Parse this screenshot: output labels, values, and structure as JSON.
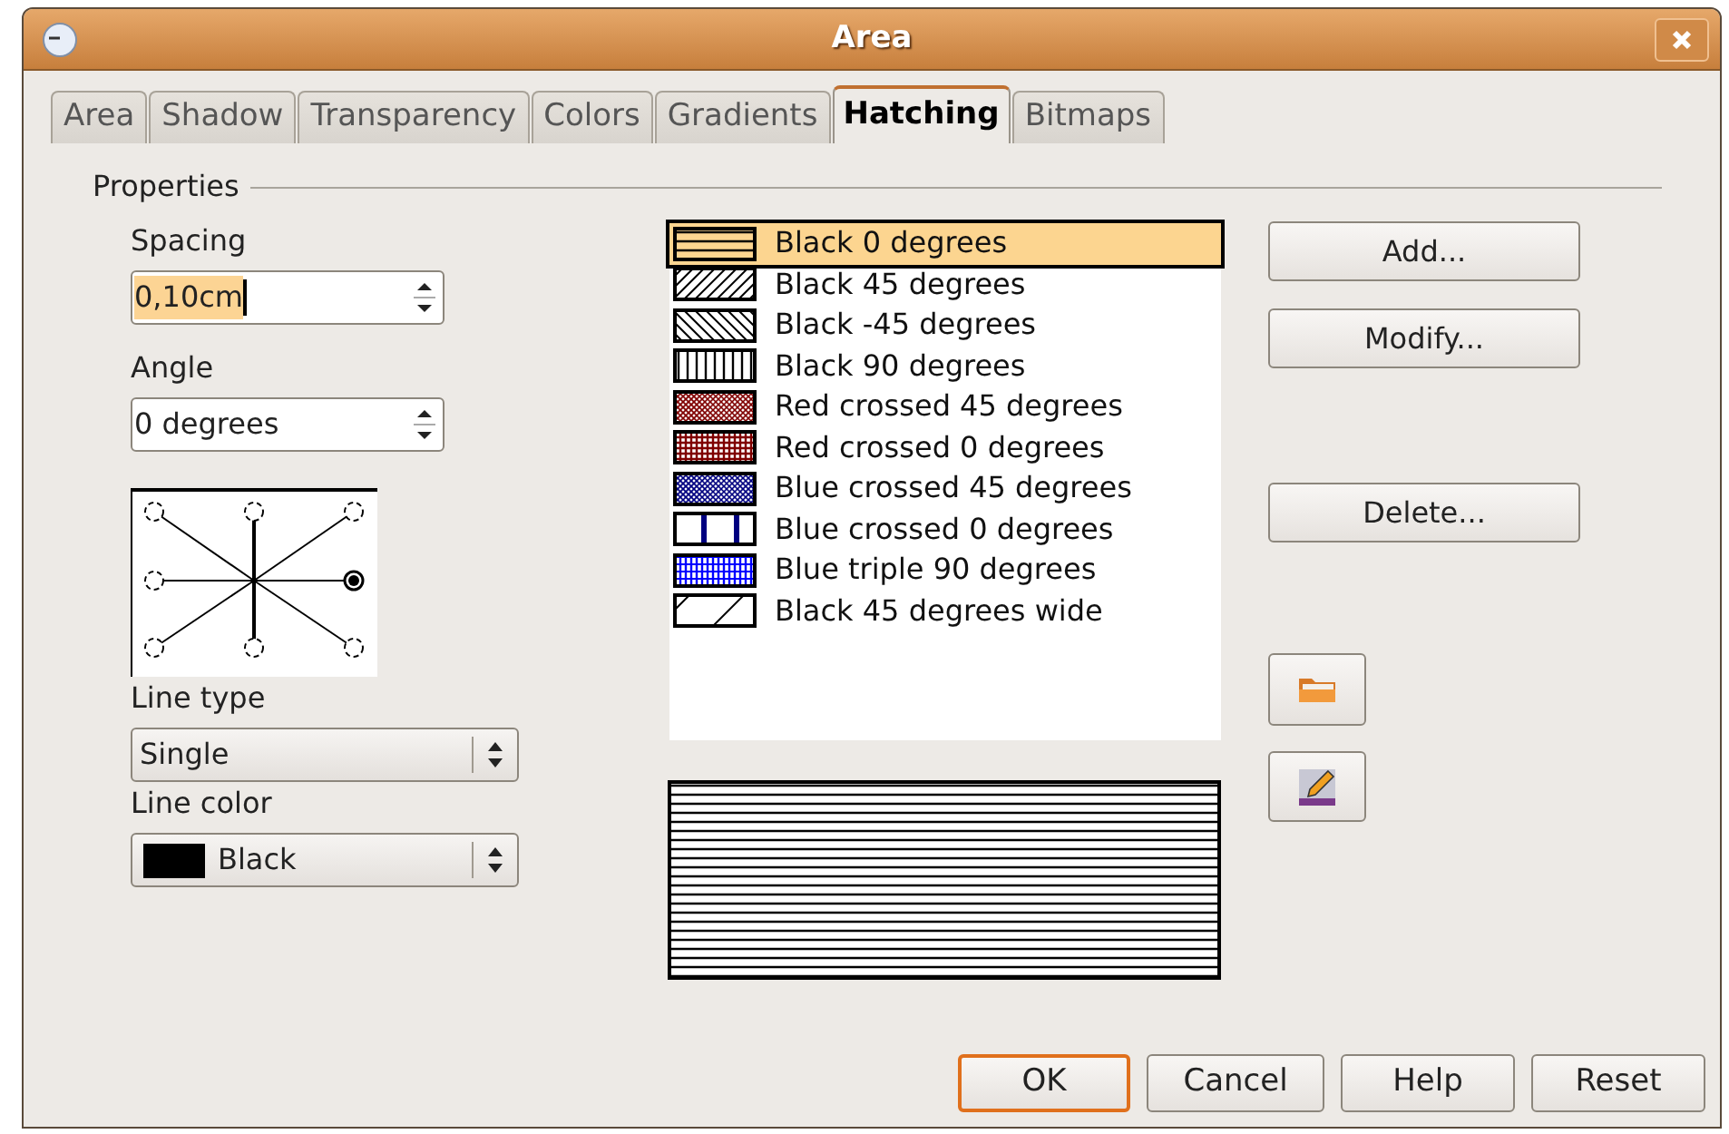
{
  "window": {
    "title": "Area"
  },
  "tabs": [
    {
      "label": "Area",
      "selected": false
    },
    {
      "label": "Shadow",
      "selected": false
    },
    {
      "label": "Transparency",
      "selected": false
    },
    {
      "label": "Colors",
      "selected": false
    },
    {
      "label": "Gradients",
      "selected": false
    },
    {
      "label": "Hatching",
      "selected": true
    },
    {
      "label": "Bitmaps",
      "selected": false
    }
  ],
  "properties": {
    "title": "Properties",
    "spacing": {
      "label": "Spacing",
      "value": "0,10cm"
    },
    "angle": {
      "label": "Angle",
      "value": "0 degrees"
    },
    "angle_points": [
      {
        "selected": false
      },
      {
        "selected": false
      },
      {
        "selected": false
      },
      {
        "selected": false
      },
      {
        "selected": true
      },
      {
        "selected": false
      },
      {
        "selected": false
      },
      {
        "selected": false
      }
    ],
    "line_type": {
      "label": "Line type",
      "value": "Single"
    },
    "line_color": {
      "label": "Line color",
      "value": "Black",
      "color": "#000000"
    }
  },
  "hatches": [
    {
      "label": "Black 0 degrees",
      "kind": "horizontal",
      "color": "#000000",
      "selected": true
    },
    {
      "label": "Black 45 degrees",
      "kind": "diagonal",
      "color": "#000000",
      "selected": false
    },
    {
      "label": "Black -45 degrees",
      "kind": "antidiagonal",
      "color": "#000000",
      "selected": false
    },
    {
      "label": "Black 90 degrees",
      "kind": "vertical",
      "color": "#000000",
      "selected": false
    },
    {
      "label": "Red crossed 45 degrees",
      "kind": "cross-diagonal",
      "color": "#800000",
      "selected": false
    },
    {
      "label": "Red crossed 0 degrees",
      "kind": "cross",
      "color": "#800000",
      "selected": false
    },
    {
      "label": "Blue crossed 45 degrees",
      "kind": "cross-diagonal",
      "color": "#000080",
      "selected": false
    },
    {
      "label": "Blue crossed 0 degrees",
      "kind": "cross-wide",
      "color": "#000080",
      "selected": false
    },
    {
      "label": "Blue triple 90 degrees",
      "kind": "triple",
      "color": "#0000ff",
      "selected": false
    },
    {
      "label": "Black 45 degrees wide",
      "kind": "diagonal-wide",
      "color": "#000000",
      "selected": false
    }
  ],
  "side_buttons": [
    "Add...",
    "Modify...",
    "Delete..."
  ],
  "buttons": [
    {
      "label": "OK",
      "default": true
    },
    {
      "label": "Cancel",
      "default": false
    },
    {
      "label": "Help",
      "default": false
    },
    {
      "label": "Reset",
      "default": false
    }
  ]
}
